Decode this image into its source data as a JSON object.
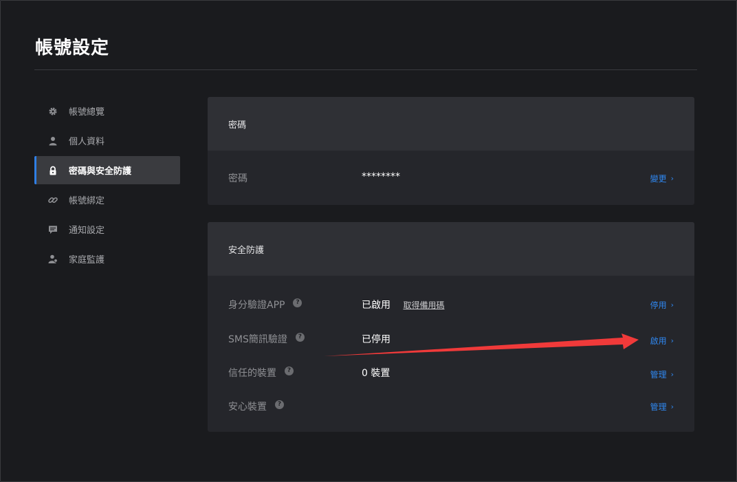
{
  "page": {
    "title": "帳號設定"
  },
  "sidebar": {
    "items": [
      {
        "label": "帳號總覽",
        "icon": "gear-icon",
        "active": false
      },
      {
        "label": "個人資料",
        "icon": "user-icon",
        "active": false
      },
      {
        "label": "密碼與安全防護",
        "icon": "lock-icon",
        "active": true
      },
      {
        "label": "帳號綁定",
        "icon": "link-icon",
        "active": false
      },
      {
        "label": "通知設定",
        "icon": "message-icon",
        "active": false
      },
      {
        "label": "家庭監護",
        "icon": "family-icon",
        "active": false
      }
    ]
  },
  "password_card": {
    "title": "密碼",
    "row": {
      "label": "密碼",
      "value": "********",
      "action": "變更"
    }
  },
  "security_card": {
    "title": "安全防護",
    "rows": [
      {
        "label": "身分驗證APP",
        "value": "已啟用",
        "extra_link": "取得備用碼",
        "action": "停用"
      },
      {
        "label": "SMS簡訊驗證",
        "value": "已停用",
        "action": "啟用"
      },
      {
        "label": "信任的裝置",
        "value": "0 裝置",
        "action": "管理"
      },
      {
        "label": "安心裝置",
        "value": "",
        "action": "管理"
      }
    ]
  },
  "colors": {
    "accent": "#2f87f0",
    "annotation_arrow": "#f03a3a"
  }
}
